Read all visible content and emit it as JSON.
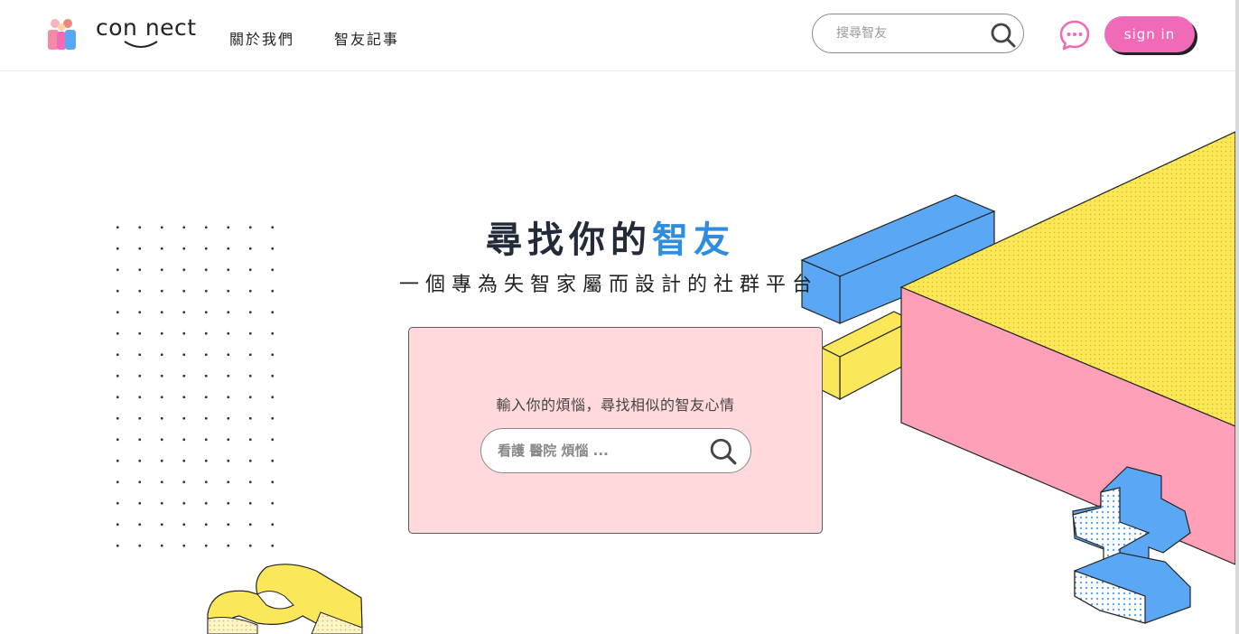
{
  "brand": {
    "name": "con nect"
  },
  "nav": {
    "about": "關於我們",
    "diary": "智友記事"
  },
  "header_search": {
    "placeholder": "搜尋智友"
  },
  "auth": {
    "signin_label": "sign in"
  },
  "hero": {
    "title_main": "尋找你的",
    "title_accent": "智友",
    "subtitle": "一個專為失智家屬而設計的社群平台"
  },
  "finder": {
    "prompt": "輸入你的煩惱，尋找相似的智友心情",
    "placeholder": "看護 醫院 煩惱 ..."
  },
  "colors": {
    "brand_pink": "#f06ab8",
    "accent_blue": "#2f8de0",
    "card_bg": "#ffd9dc",
    "deco_yellow": "#fbe85a",
    "deco_pink": "#ffa0b8",
    "deco_blue": "#5aa8f5"
  },
  "icons": {
    "search": "search-icon",
    "chat": "chat-bubble-icon",
    "logo": "people-logo-icon"
  }
}
